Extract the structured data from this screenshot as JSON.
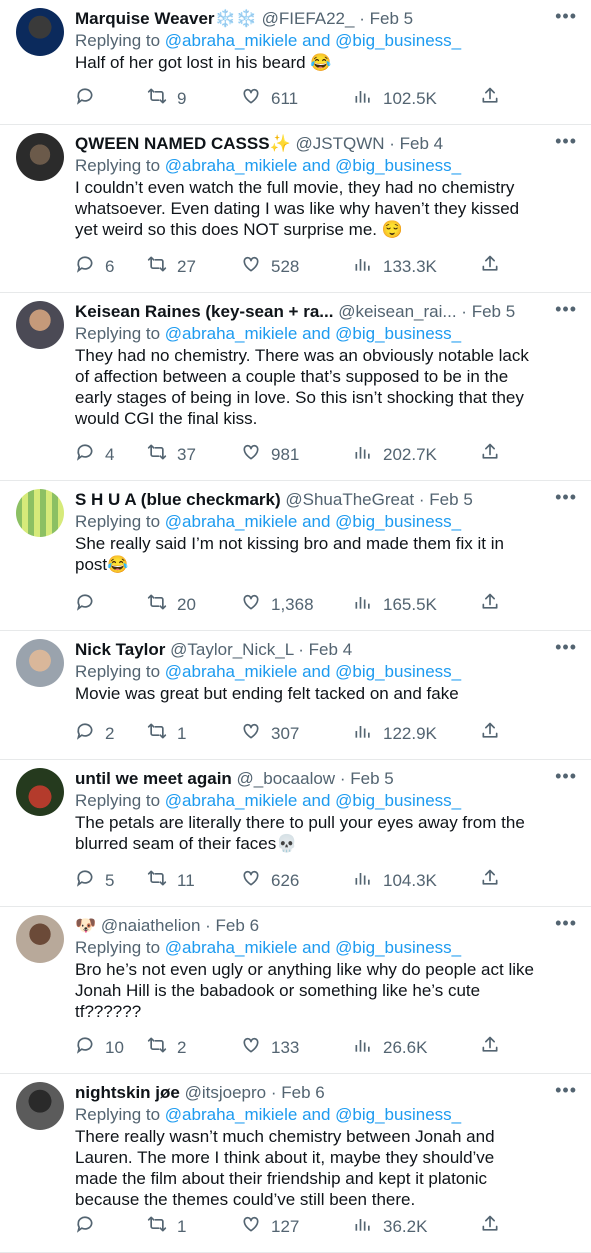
{
  "reply_prefix": "Replying to",
  "reply_handles": "@abraha_mikiele and @big_business_",
  "more_glyph": "•••",
  "colors": {
    "link": "#1d9bf0",
    "muted": "#536471",
    "text": "#0f1419",
    "divider": "#e7e9ea"
  },
  "tweets": [
    {
      "name": "Marquise Weaver",
      "name_suffix": "❄️❄️",
      "handle": "@FIEFA22_",
      "date": "Feb 5",
      "lines": [
        "Half of her got lost in his beard 😂"
      ],
      "replies": "",
      "retweets": "9",
      "likes": "611",
      "views": "102.5K"
    },
    {
      "name": "QWEEN NAMED CASSS",
      "name_suffix": "✨",
      "handle": "@JSTQWN",
      "date": "Feb 4",
      "lines": [
        "I couldn’t even watch the full movie, they had no chemistry",
        "whatsoever. Even dating I was like why haven’t they kissed",
        "yet weird so this does NOT surprise me. 😌"
      ],
      "replies": "6",
      "retweets": "27",
      "likes": "528",
      "views": "133.3K"
    },
    {
      "name": "Keisean Raines (key-sean + ra...",
      "name_suffix": "",
      "handle": "@keisean_rai...",
      "date": "Feb 5",
      "lines": [
        "They had no chemistry.  There was an obviously notable lack",
        "of affection between a couple that’s supposed to be in the",
        "early stages of being in love.  So this isn’t shocking that they",
        "would CGI the final kiss."
      ],
      "replies": "4",
      "retweets": "37",
      "likes": "981",
      "views": "202.7K"
    },
    {
      "name": "S H U A (blue checkmark)",
      "name_suffix": "",
      "handle": "@ShuaTheGreat",
      "date": "Feb 5",
      "lines": [
        "She really said I’m not kissing bro and made them fix it in",
        "post😂"
      ],
      "replies": "",
      "retweets": "20",
      "likes": "1,368",
      "views": "165.5K"
    },
    {
      "name": "Nick Taylor",
      "name_suffix": "",
      "handle": "@Taylor_Nick_L",
      "date": "Feb 4",
      "lines": [
        "Movie was great but ending felt tacked on and fake"
      ],
      "replies": "2",
      "retweets": "1",
      "likes": "307",
      "views": "122.9K"
    },
    {
      "name": "until we meet again",
      "name_suffix": "",
      "handle": "@_bocaalow",
      "date": "Feb 5",
      "lines": [
        "The petals are literally there to pull your eyes away from the",
        "blurred seam of their faces💀"
      ],
      "replies": "5",
      "retweets": "11",
      "likes": "626",
      "views": "104.3K"
    },
    {
      "name": "🐶",
      "name_suffix": "",
      "handle": "@naiathelion",
      "date": "Feb 6",
      "lines": [
        "Bro he’s not even ugly or anything like why do people act like",
        "Jonah Hill is the babadook or something like he’s cute",
        "tf??????"
      ],
      "replies": "10",
      "retweets": "2",
      "likes": "133",
      "views": "26.6K"
    },
    {
      "name": "nightskin jøe",
      "name_suffix": "",
      "handle": "@itsjoepro",
      "date": "Feb 6",
      "lines": [
        "There really wasn’t much chemistry between Jonah and",
        "Lauren. The more I think about it, maybe they should’ve",
        "made the film about their friendship and kept it platonic",
        "because the themes could’ve still been there."
      ],
      "replies": "",
      "retweets": "1",
      "likes": "127",
      "views": "36.2K"
    }
  ]
}
